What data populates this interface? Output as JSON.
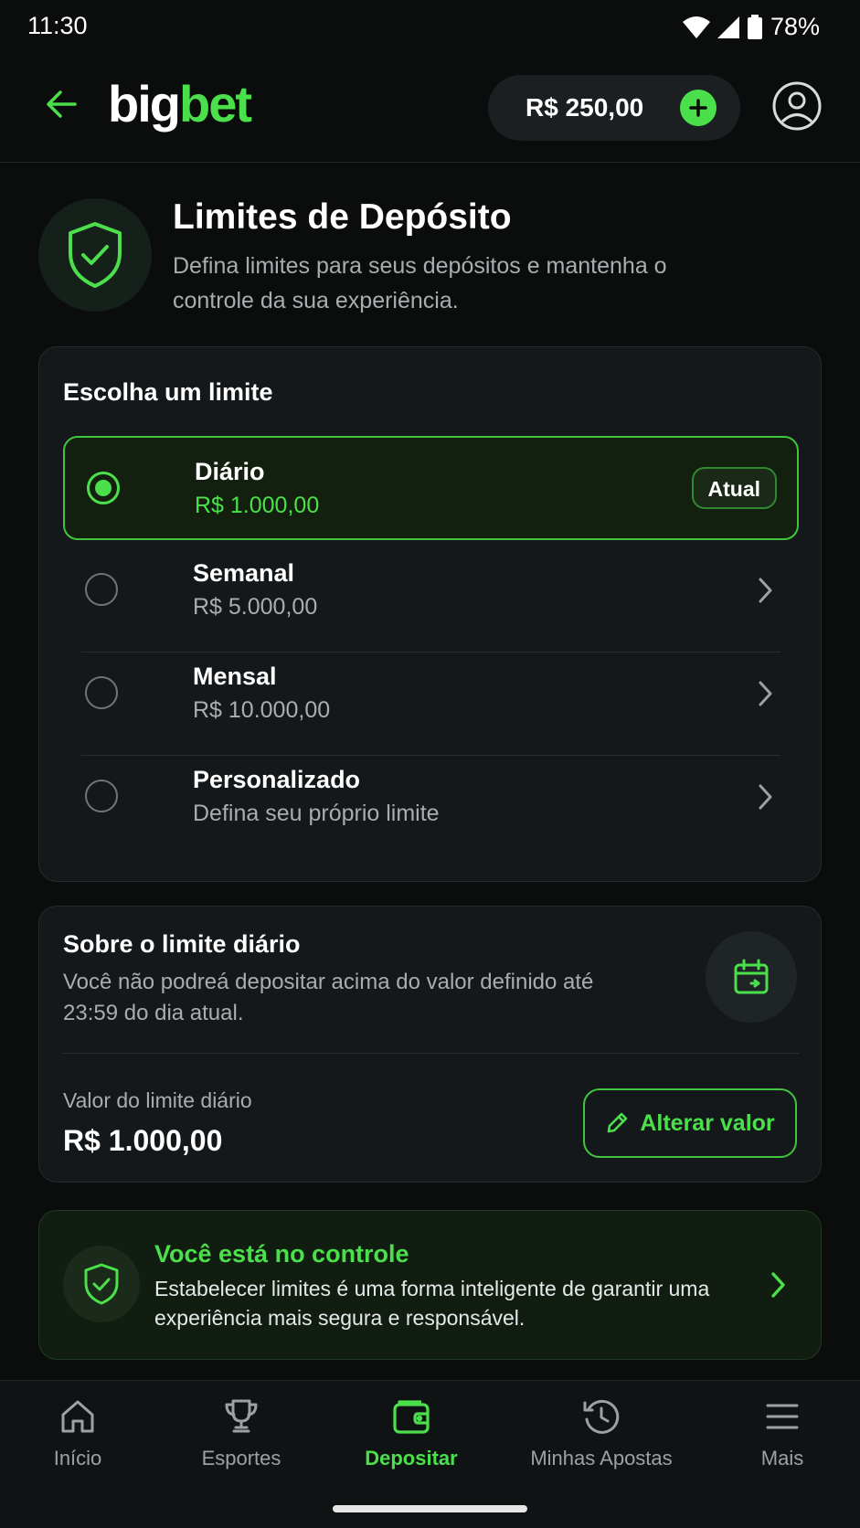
{
  "status_bar": {
    "time": "11:30",
    "battery": "78%"
  },
  "header": {
    "logo_part1": "big",
    "logo_part2": "bet",
    "balance": "R$ 250,00",
    "icons": {
      "back": "arrow-left-icon",
      "add": "plus-icon",
      "profile": "user-circle-icon"
    }
  },
  "page": {
    "title": "Limites de Depósito",
    "subtitle": "Defina limites para seus depósitos e mantenha o controle da sua experiência.",
    "icon": "shield-check-icon"
  },
  "limits": {
    "heading": "Escolha um limite",
    "options": [
      {
        "label": "Diário",
        "value": "R$ 1.000,00",
        "selected": true,
        "badge": "Atual"
      },
      {
        "label": "Semanal",
        "value": "R$ 5.000,00",
        "selected": false
      },
      {
        "label": "Mensal",
        "value": "R$ 10.000,00",
        "selected": false
      },
      {
        "label": "Personalizado",
        "value": "Defina seu próprio limite",
        "selected": false
      }
    ]
  },
  "about": {
    "title": "Sobre o limite diário",
    "text": "Você não podreá depositar acima do valor definido até 23:59 do dia atual.",
    "icon": "calendar-icon",
    "limit_label": "Valor do limite diário",
    "limit_value": "R$ 1.000,00",
    "button_label": "Alterar valor"
  },
  "control": {
    "title": "Você está no controle",
    "text": "Estabelecer limites é uma forma inteligente de garantir uma experiência mais segura e responsável."
  },
  "nav": {
    "items": [
      {
        "label": "Início",
        "icon": "home-icon",
        "active": false
      },
      {
        "label": "Esportes",
        "icon": "trophy-icon",
        "active": false
      },
      {
        "label": "Depositar",
        "icon": "wallet-icon",
        "active": true
      },
      {
        "label": "Minhas Apostas",
        "icon": "history-icon",
        "active": false
      },
      {
        "label": "Mais",
        "icon": "menu-icon",
        "active": false
      }
    ]
  },
  "colors": {
    "accent": "#4be04b",
    "background": "#0b0d0d",
    "card": "#15181a"
  }
}
